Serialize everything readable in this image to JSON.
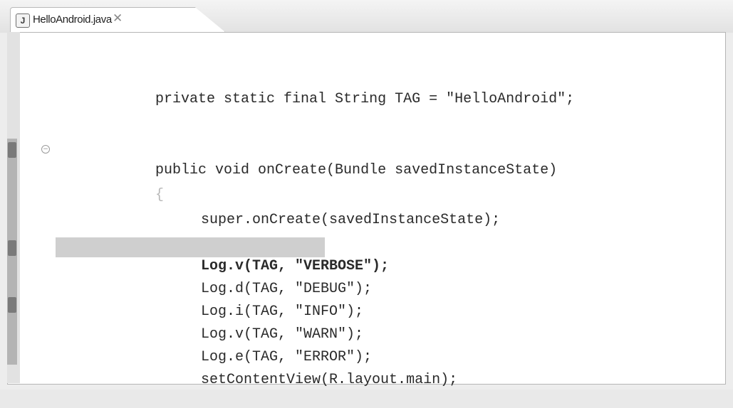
{
  "tab": {
    "icon": "java-file-icon",
    "icon_glyph": "J",
    "label": "HelloAndroid.java",
    "close_glyph": "✕"
  },
  "code_lines": [
    "private static final String TAG = \"HelloAndroid\";",
    "public void onCreate(Bundle savedInstanceState)",
    "{",
    "super.onCreate(savedInstanceState);",
    "Log.v(TAG, \"VERBOSE\");",
    "Log.d(TAG, \"DEBUG\");",
    "Log.i(TAG, \"INFO\");",
    "Log.v(TAG, \"WARN\");",
    "Log.e(TAG, \"ERROR\");",
    "setContentView(R.layout.main);"
  ],
  "highlighted_line_index": 4,
  "colors": {
    "highlight": "#cfcfcf",
    "editor_background": "#ffffff",
    "ruler": "#e2e2e2"
  }
}
